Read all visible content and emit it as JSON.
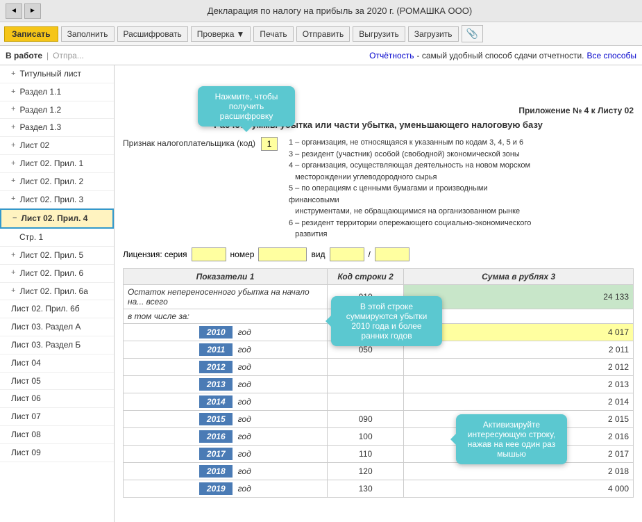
{
  "titleBar": {
    "title": "Декларация по налогу на прибыль за 2020 г. (РОМАШКА ООО)",
    "backLabel": "◄",
    "forwardLabel": "►"
  },
  "toolbar": {
    "zapisat": "Записать",
    "zapolnit": "Заполнить",
    "rasshifrovat": "Расшифровать",
    "proverka": "Проверка",
    "pechat": "Печать",
    "otpravit": "Отправить",
    "vygruzit": "Выгрузить",
    "zagruzit": "Загрузить",
    "clip": "📎"
  },
  "statusBar": {
    "status": "В работе",
    "otpravit": "Отпра...",
    "otchetnost": "Отчётность",
    "desc": "- самый удобный способ сдачи отчетности.",
    "vseSposoby": "Все способы"
  },
  "sidebar": {
    "items": [
      {
        "label": "Титульный лист",
        "level": 1,
        "icon": "+",
        "active": false
      },
      {
        "label": "Раздел 1.1",
        "level": 1,
        "icon": "+",
        "active": false
      },
      {
        "label": "Раздел 1.2",
        "level": 1,
        "icon": "+",
        "active": false
      },
      {
        "label": "Раздел 1.3",
        "level": 1,
        "icon": "+",
        "active": false
      },
      {
        "label": "Лист 02",
        "level": 1,
        "icon": "+",
        "active": false
      },
      {
        "label": "Лист 02. Прил. 1",
        "level": 1,
        "icon": "+",
        "active": false
      },
      {
        "label": "Лист 02. Прил. 2",
        "level": 1,
        "icon": "+",
        "active": false
      },
      {
        "label": "Лист 02. Прил. 3",
        "level": 1,
        "icon": "+",
        "active": false
      },
      {
        "label": "Лист 02. Прил. 4",
        "level": 1,
        "icon": "−",
        "active": true
      },
      {
        "label": "Стр. 1",
        "level": 2,
        "icon": "",
        "active": false
      },
      {
        "label": "Лист 02. Прил. 5",
        "level": 1,
        "icon": "+",
        "active": false
      },
      {
        "label": "Лист 02. Прил. 6",
        "level": 1,
        "icon": "+",
        "active": false
      },
      {
        "label": "Лист 02. Прил. 6а",
        "level": 1,
        "icon": "+",
        "active": false
      },
      {
        "label": "Лист 02. Прил. 6б",
        "level": 1,
        "icon": "",
        "active": false
      },
      {
        "label": "Лист 03. Раздел А",
        "level": 1,
        "icon": "",
        "active": false
      },
      {
        "label": "Лист 03. Раздел Б",
        "level": 1,
        "icon": "",
        "active": false
      },
      {
        "label": "Лист 04",
        "level": 1,
        "icon": "",
        "active": false
      },
      {
        "label": "Лист 05",
        "level": 1,
        "icon": "",
        "active": false
      },
      {
        "label": "Лист 06",
        "level": 1,
        "icon": "",
        "active": false
      },
      {
        "label": "Лист 07",
        "level": 1,
        "icon": "",
        "active": false
      },
      {
        "label": "Лист 08",
        "level": 1,
        "icon": "",
        "active": false
      },
      {
        "label": "Лист 09",
        "level": 1,
        "icon": "",
        "active": false
      }
    ]
  },
  "tooltips": {
    "rasshifrovat": {
      "text": "Нажмите, чтобы получить расшифровку"
    },
    "summiruutsya": {
      "text": "В этой строке суммируются убытки 2010 года и более ранних годов"
    },
    "aktiviziruyte": {
      "text": "Активизируйте интересующую строку, нажав на нее один раз мышью"
    }
  },
  "content": {
    "appendixTitle": "Приложение № 4 к Листу 02",
    "subtitle": "Расчет суммы убытка или части убытка, уменьшающего налоговую базу",
    "priznak": {
      "label": "Признак налогоплательщика (код)",
      "value": "1",
      "descriptions": [
        "1 – организация, не относящаяся к указанным по кодам 3, 4, 5 и 6",
        "3 – резидент (участник) особой (свободной) экономической зоны",
        "4 – организация, осуществляющая деятельность на новом морском месторождении углеводородного сырья",
        "5 – по операциям с ценными бумагами и производными финансовыми инструментами, не обращающимися на организованном рынке",
        "6 – резидент территории опережающего социально-экономического развития"
      ]
    },
    "license": {
      "label": "Лицензия:  серия",
      "nomerLabel": "номер",
      "vidLabel": "вид"
    },
    "tableHeaders": {
      "col1": "Показатели 1",
      "col2": "Код строки 2",
      "col3": "Сумма в рублях 3"
    },
    "rows": [
      {
        "indicator": "Остаток непереносенного убытка на начало на... всего",
        "code": "010",
        "value": "24 133",
        "valueClass": "value-green",
        "year": null,
        "godLabel": null
      },
      {
        "indicator": "в том числе за:",
        "code": "",
        "value": "",
        "valueClass": "",
        "year": null,
        "godLabel": null
      },
      {
        "indicator": "",
        "code": "040",
        "value": "4 017",
        "valueClass": "value-yellow",
        "year": "2010",
        "godLabel": "год"
      },
      {
        "indicator": "",
        "code": "050",
        "value": "2 011",
        "valueClass": "value-normal",
        "year": "2011",
        "godLabel": "год"
      },
      {
        "indicator": "",
        "code": "",
        "value": "2 012",
        "valueClass": "value-normal",
        "year": "2012",
        "godLabel": "год"
      },
      {
        "indicator": "",
        "code": "",
        "value": "2 013",
        "valueClass": "value-normal",
        "year": "2013",
        "godLabel": "год"
      },
      {
        "indicator": "",
        "code": "",
        "value": "2 014",
        "valueClass": "value-normal",
        "year": "2014",
        "godLabel": "год"
      },
      {
        "indicator": "",
        "code": "090",
        "value": "2 015",
        "valueClass": "value-normal",
        "year": "2015",
        "godLabel": "год"
      },
      {
        "indicator": "",
        "code": "100",
        "value": "2 016",
        "valueClass": "value-normal",
        "year": "2016",
        "godLabel": "год"
      },
      {
        "indicator": "",
        "code": "110",
        "value": "2 017",
        "valueClass": "value-normal",
        "year": "2017",
        "godLabel": "год"
      },
      {
        "indicator": "",
        "code": "120",
        "value": "2 018",
        "valueClass": "value-normal",
        "year": "2018",
        "godLabel": "год"
      },
      {
        "indicator": "",
        "code": "130",
        "value": "4 000",
        "valueClass": "value-normal",
        "year": "2019",
        "godLabel": "год"
      }
    ]
  }
}
